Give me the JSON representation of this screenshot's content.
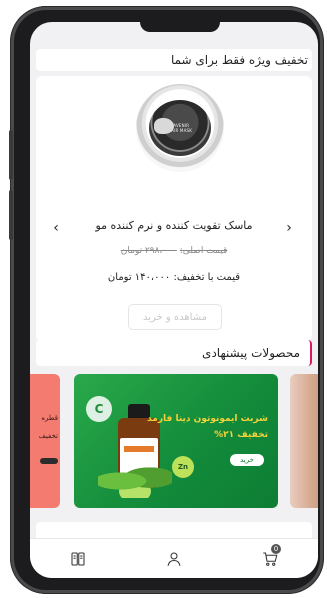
{
  "deal": {
    "header": "تخفیف ویژه فقط برای شما",
    "product_name": "ماسک تقویت کننده و نرم کننده مو",
    "original_price_label": "قیمت اصلی:",
    "original_price_value": "۲۹۸،۰۰۰ تومان",
    "discount_price": "قیمت با تخفیف: ۱۴۰،۰۰۰ تومان",
    "view_button": "مشاهده و خرید",
    "jar_text": "HAIR MASK",
    "jar_sub": "LAVENIR",
    "prev_arrow": "‹",
    "next_arrow": "›"
  },
  "suggested": {
    "header": "محصولات پیشنهادی",
    "left_card": {
      "line1": "قطره",
      "line2": "تخفیف"
    },
    "green_card": {
      "title": "شربت ایمونوتون دینا فارمد",
      "discount": "تخفیف ۲۱%",
      "button": "خرید",
      "badge": "C",
      "badge_small": "Zn"
    }
  },
  "bottom_nav": {
    "cart_count": "0",
    "icons": [
      "cart-icon",
      "user-icon",
      "book-icon"
    ]
  },
  "colors": {
    "accent": "#d81b60",
    "green_banner": "#128a3a",
    "red_card": "#f37b70",
    "promo_text": "#f4d23a"
  }
}
